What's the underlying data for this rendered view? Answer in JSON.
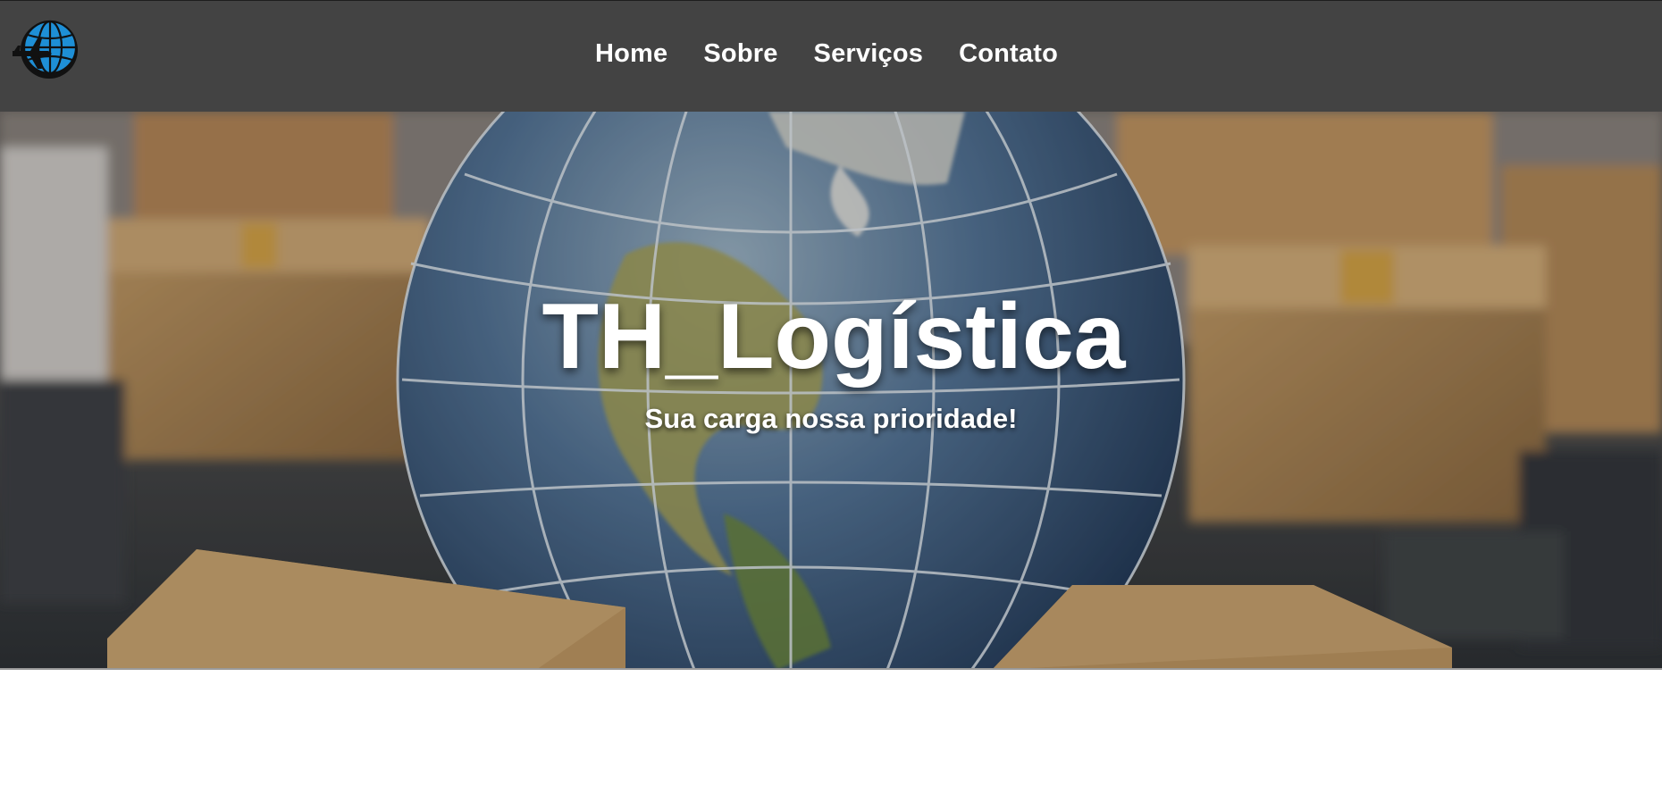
{
  "header": {
    "logo_icon": "globe-airplane-icon",
    "background_color": "#434343",
    "nav": [
      {
        "label": "Home"
      },
      {
        "label": "Sobre"
      },
      {
        "label": "Serviços"
      },
      {
        "label": "Contato"
      }
    ]
  },
  "hero": {
    "title": "TH_Logística",
    "subtitle": "Sua carga nossa prioridade!",
    "background_image": "globe-with-cardboard-boxes"
  },
  "colors": {
    "nav_text": "#ffffff",
    "logo_blue": "#1e8fd6",
    "logo_dark": "#111111"
  }
}
